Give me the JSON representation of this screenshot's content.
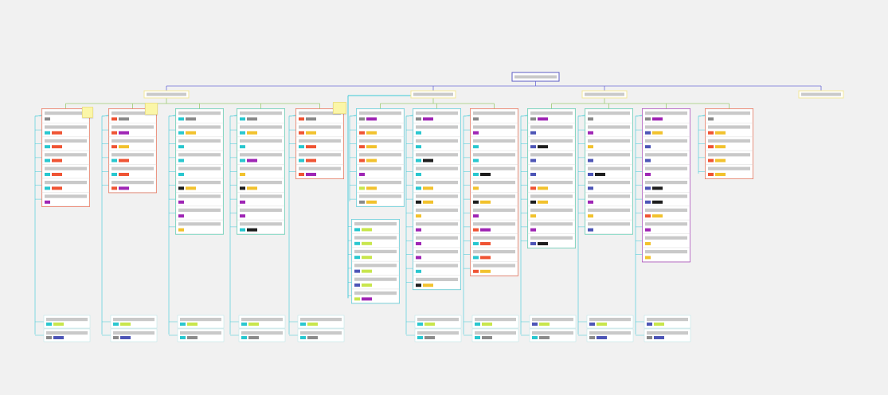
{
  "diagram": {
    "kind": "hierarchy-board",
    "colors": {
      "background": "#f1f1f1",
      "root_border": "#5b5bc4",
      "root_connector": "#6b6bd6",
      "group_border": "#f2e79a",
      "group_connector": "#9ccb72",
      "column_connector": "#3cc9d7",
      "placeholder_text": "#c9c9c9",
      "sticky_note": "#fbf6a8"
    },
    "tag_palette": {
      "cyan": "#29c7cf",
      "red": "#ef5434",
      "orange": "#f2c22e",
      "purple": "#9f26b5",
      "lime": "#c8e64c",
      "gray": "#8b8b8b",
      "black": "#1e1e1e",
      "navy": "#4d55b6"
    },
    "root": {
      "name": "root-node"
    },
    "groups": [
      {
        "name": "group-1",
        "columns": 4,
        "notes": []
      },
      {
        "name": "group-2",
        "columns": 5
      },
      {
        "name": "group-3",
        "columns": 3
      },
      {
        "name": "group-4",
        "columns": 0
      }
    ],
    "notes": [
      {
        "name": "sticky-note-1",
        "text": ""
      },
      {
        "name": "sticky-note-2",
        "text": ""
      },
      {
        "name": "sticky-note-3",
        "text": ""
      }
    ],
    "columns": [
      {
        "name": "column-1",
        "accent": "#ef5434",
        "cards": [
          [
            "gray"
          ],
          [
            "cyan",
            "red"
          ],
          [
            "cyan",
            "red"
          ],
          [
            "cyan",
            "red"
          ],
          [
            "cyan",
            "red"
          ],
          [
            "cyan",
            "red"
          ],
          [
            "purple"
          ]
        ],
        "footer": [
          [
            "cyan",
            "lime"
          ],
          [
            "gray",
            "navy"
          ]
        ]
      },
      {
        "name": "column-2",
        "accent": "#ef5434",
        "cards": [
          [
            "red",
            "gray"
          ],
          [
            "red",
            "purple"
          ],
          [
            "red",
            "orange"
          ],
          [
            "cyan",
            "red"
          ],
          [
            "cyan",
            "red"
          ],
          [
            "red",
            "purple"
          ]
        ],
        "footer": [
          [
            "cyan",
            "lime"
          ],
          [
            "gray",
            "navy"
          ]
        ]
      },
      {
        "name": "column-3",
        "accent": "#3cc9a7",
        "cards": [
          [
            "cyan",
            "gray"
          ],
          [
            "cyan",
            "orange"
          ],
          [
            "cyan"
          ],
          [
            "cyan"
          ],
          [
            "cyan"
          ],
          [
            "black",
            "orange"
          ],
          [
            "purple"
          ],
          [
            "purple"
          ],
          [
            "orange"
          ]
        ],
        "footer": [
          [
            "cyan",
            "lime"
          ],
          [
            "cyan",
            "gray"
          ]
        ]
      },
      {
        "name": "column-4",
        "accent": "#3cc9a7",
        "cards": [
          [
            "cyan",
            "gray"
          ],
          [
            "cyan",
            "orange"
          ],
          [
            "cyan"
          ],
          [
            "cyan",
            "purple"
          ],
          [
            "orange"
          ],
          [
            "black",
            "orange"
          ],
          [
            "purple"
          ],
          [
            "purple"
          ],
          [
            "cyan",
            "black"
          ]
        ],
        "footer": [
          [
            "cyan",
            "lime"
          ],
          [
            "cyan",
            "gray"
          ]
        ]
      },
      {
        "name": "column-5",
        "accent": "#ef5434",
        "cards": [
          [
            "red",
            "gray"
          ],
          [
            "red",
            "orange"
          ],
          [
            "cyan",
            "red"
          ],
          [
            "cyan",
            "red"
          ],
          [
            "red",
            "purple"
          ]
        ],
        "footer": [
          [
            "cyan",
            "lime"
          ],
          [
            "cyan",
            "gray"
          ]
        ]
      },
      {
        "name": "column-6",
        "accent": "#3cc9d7",
        "cards": [
          [
            "gray",
            "purple"
          ],
          [
            "red",
            "orange"
          ],
          [
            "red",
            "orange"
          ],
          [
            "red",
            "orange"
          ],
          [
            "purple"
          ],
          [
            "lime",
            "orange"
          ],
          [
            "gray",
            "orange"
          ]
        ],
        "subcards": [
          [
            "cyan",
            "lime"
          ],
          [
            "cyan",
            "lime"
          ],
          [
            "cyan",
            "lime"
          ],
          [
            "navy",
            "lime"
          ],
          [
            "navy",
            "lime"
          ],
          [
            "lime",
            "purple"
          ]
        ],
        "footer": []
      },
      {
        "name": "column-7",
        "accent": "#3cc9d7",
        "cards": [
          [
            "gray",
            "purple"
          ],
          [
            "cyan"
          ],
          [
            "cyan"
          ],
          [
            "cyan",
            "black"
          ],
          [
            "cyan"
          ],
          [
            "cyan",
            "orange"
          ],
          [
            "black",
            "orange"
          ],
          [
            "orange"
          ],
          [
            "purple"
          ],
          [
            "purple"
          ],
          [
            "purple"
          ],
          [
            "cyan"
          ],
          [
            "black",
            "orange"
          ]
        ],
        "footer": [
          [
            "cyan",
            "lime"
          ],
          [
            "cyan",
            "gray"
          ]
        ]
      },
      {
        "name": "column-8",
        "accent": "#ef5434",
        "cards": [
          [
            "gray"
          ],
          [
            "purple"
          ],
          [
            "cyan"
          ],
          [
            "cyan"
          ],
          [
            "cyan",
            "black"
          ],
          [
            "orange"
          ],
          [
            "black",
            "orange"
          ],
          [
            "purple"
          ],
          [
            "red",
            "purple"
          ],
          [
            "cyan",
            "red"
          ],
          [
            "cyan",
            "red"
          ],
          [
            "red",
            "orange"
          ]
        ],
        "footer": [
          [
            "cyan",
            "lime"
          ],
          [
            "cyan",
            "gray"
          ]
        ]
      },
      {
        "name": "column-9",
        "accent": "#3cc9a7",
        "cards": [
          [
            "gray",
            "purple"
          ],
          [
            "navy"
          ],
          [
            "navy",
            "black"
          ],
          [
            "navy"
          ],
          [
            "navy"
          ],
          [
            "red",
            "orange"
          ],
          [
            "black",
            "orange"
          ],
          [
            "orange"
          ],
          [
            "purple"
          ],
          [
            "navy",
            "black"
          ]
        ],
        "footer": [
          [
            "navy",
            "lime"
          ],
          [
            "cyan",
            "gray"
          ]
        ]
      },
      {
        "name": "column-10",
        "accent": "#3cc9a7",
        "cards": [
          [
            "gray"
          ],
          [
            "purple"
          ],
          [
            "orange"
          ],
          [
            "navy"
          ],
          [
            "navy",
            "black"
          ],
          [
            "navy"
          ],
          [
            "purple"
          ],
          [
            "orange"
          ],
          [
            "navy"
          ]
        ],
        "footer": [
          [
            "navy",
            "lime"
          ],
          [
            "gray",
            "navy"
          ]
        ]
      },
      {
        "name": "column-11",
        "accent": "#9f26b5",
        "cards": [
          [
            "gray",
            "purple"
          ],
          [
            "navy",
            "orange"
          ],
          [
            "navy"
          ],
          [
            "navy"
          ],
          [
            "purple"
          ],
          [
            "navy",
            "black"
          ],
          [
            "navy",
            "black"
          ],
          [
            "red",
            "orange"
          ],
          [
            "purple"
          ],
          [
            "orange"
          ],
          [
            "orange"
          ]
        ],
        "footer": [
          [
            "navy",
            "lime"
          ],
          [
            "gray",
            "navy"
          ]
        ]
      },
      {
        "name": "column-12",
        "accent": "#ef5434",
        "cards": [
          [
            "gray"
          ],
          [
            "red",
            "orange"
          ],
          [
            "red",
            "orange"
          ],
          [
            "red",
            "orange"
          ],
          [
            "red",
            "orange"
          ]
        ],
        "footer": []
      }
    ]
  }
}
